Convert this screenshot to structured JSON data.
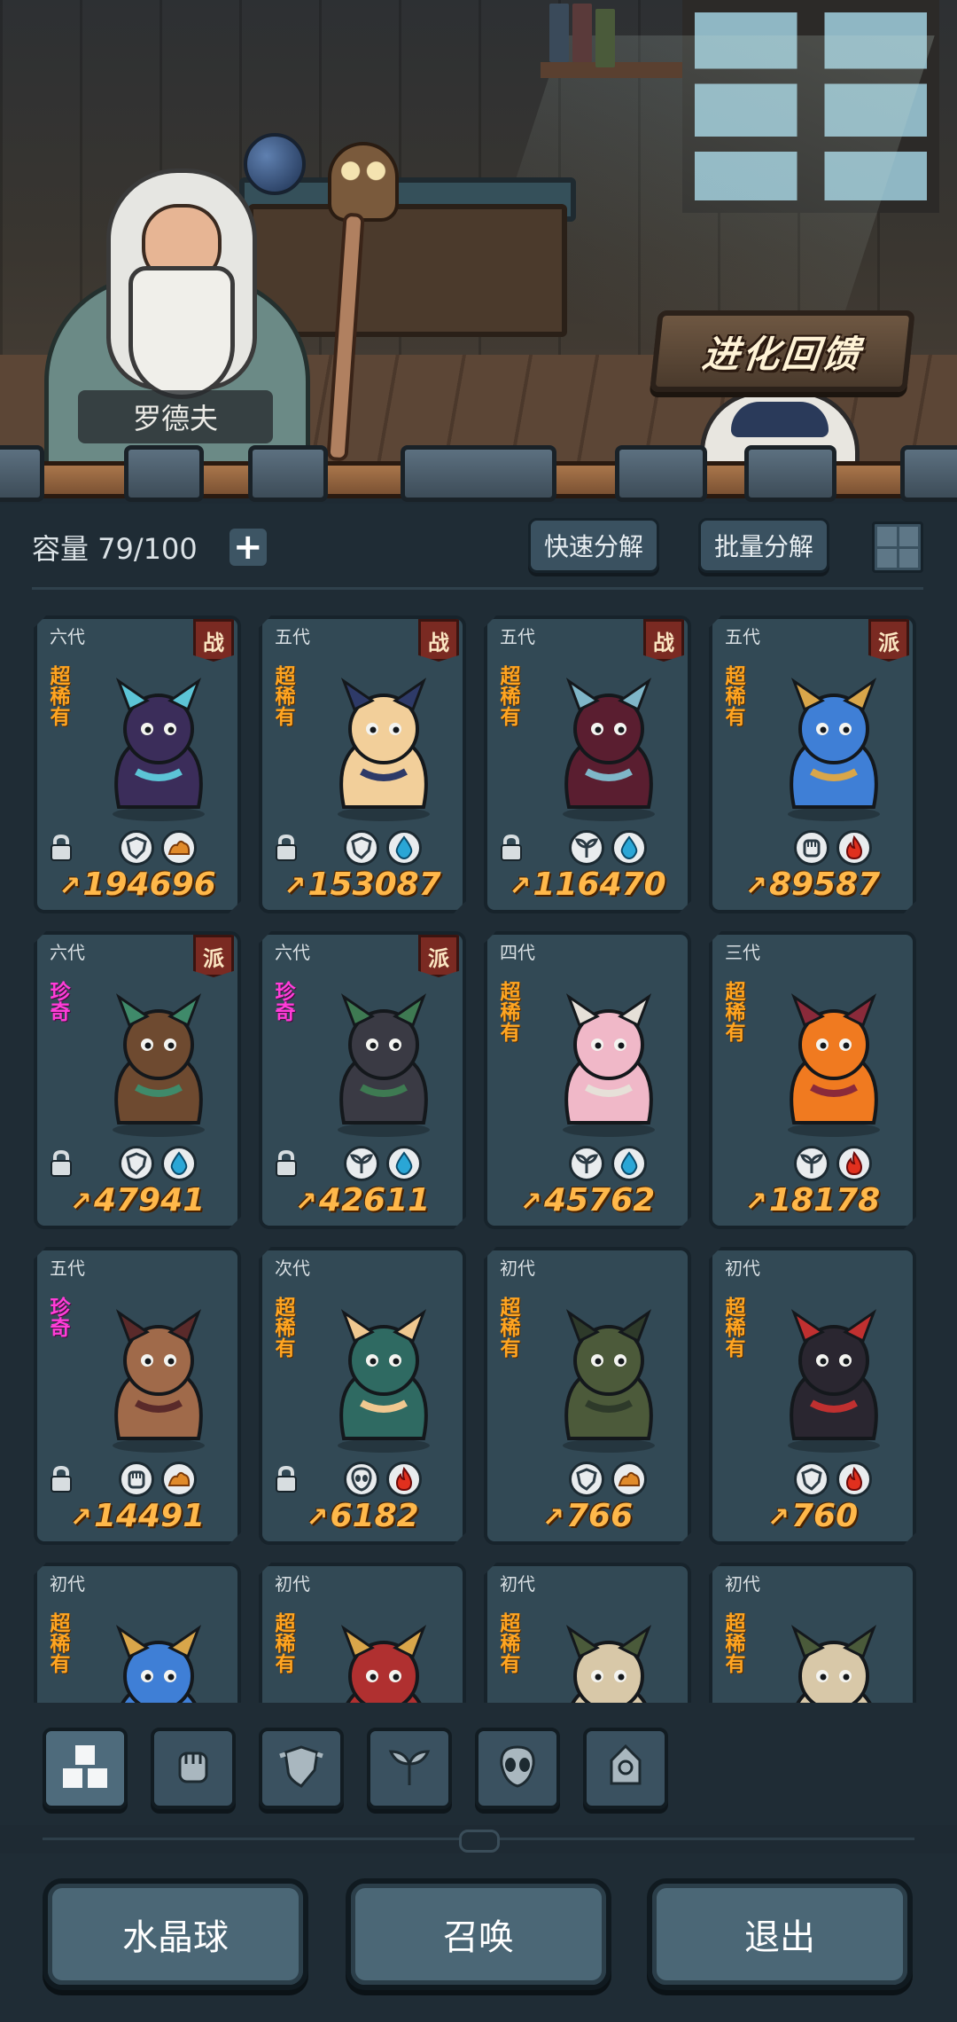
{
  "scene": {
    "npc_name": "罗德夫",
    "evolve_button": "进化回馈"
  },
  "toolbar": {
    "capacity_label": "容量 79/100",
    "add_symbol": "+",
    "quick_decompose": "快速分解",
    "batch_decompose": "批量分解"
  },
  "pets": [
    {
      "gen": "六代",
      "cls": "战",
      "rarity": "超稀有",
      "rarity_type": "ssr",
      "power": "194696",
      "locked": true,
      "badges": [
        "shield",
        "earth"
      ],
      "color": "#3b2d5a",
      "accent": "#5cc4d6"
    },
    {
      "gen": "五代",
      "cls": "战",
      "rarity": "超稀有",
      "rarity_type": "ssr",
      "power": "153087",
      "locked": true,
      "badges": [
        "shield",
        "water"
      ],
      "color": "#f2cf9a",
      "accent": "#2e3a68"
    },
    {
      "gen": "五代",
      "cls": "战",
      "rarity": "超稀有",
      "rarity_type": "ssr",
      "power": "116470",
      "locked": true,
      "badges": [
        "sprout",
        "water"
      ],
      "color": "#5a1e30",
      "accent": "#7fb6c8"
    },
    {
      "gen": "五代",
      "cls": "派",
      "rarity": "超稀有",
      "rarity_type": "ssr",
      "power": "89587",
      "locked": false,
      "badges": [
        "fist",
        "fire"
      ],
      "color": "#3f7fd6",
      "accent": "#d9a64a"
    },
    {
      "gen": "六代",
      "cls": "派",
      "rarity": "珍奇",
      "rarity_type": "rare",
      "power": "47941",
      "locked": true,
      "badges": [
        "shield",
        "water"
      ],
      "color": "#6e4a30",
      "accent": "#3f8a6a"
    },
    {
      "gen": "六代",
      "cls": "派",
      "rarity": "珍奇",
      "rarity_type": "rare",
      "power": "42611",
      "locked": true,
      "badges": [
        "sprout",
        "water"
      ],
      "color": "#3a3a44",
      "accent": "#3e7a52"
    },
    {
      "gen": "四代",
      "cls": "",
      "rarity": "超稀有",
      "rarity_type": "ssr",
      "power": "45762",
      "locked": false,
      "badges": [
        "sprout",
        "water"
      ],
      "color": "#f0b8c8",
      "accent": "#e6e0d8"
    },
    {
      "gen": "三代",
      "cls": "",
      "rarity": "超稀有",
      "rarity_type": "ssr",
      "power": "18178",
      "locked": false,
      "badges": [
        "sprout",
        "fire"
      ],
      "color": "#f07a20",
      "accent": "#8a2a3a"
    },
    {
      "gen": "五代",
      "cls": "",
      "rarity": "珍奇",
      "rarity_type": "rare",
      "power": "14491",
      "locked": true,
      "badges": [
        "fist",
        "earth"
      ],
      "color": "#a06a4a",
      "accent": "#5a2a2a"
    },
    {
      "gen": "次代",
      "cls": "",
      "rarity": "超稀有",
      "rarity_type": "ssr",
      "power": "6182",
      "locked": true,
      "badges": [
        "alien",
        "fire"
      ],
      "color": "#2f6a62",
      "accent": "#f0c890"
    },
    {
      "gen": "初代",
      "cls": "",
      "rarity": "超稀有",
      "rarity_type": "ssr",
      "power": "766",
      "locked": false,
      "badges": [
        "shield",
        "earth"
      ],
      "color": "#4c5a3a",
      "accent": "#2e3a2a"
    },
    {
      "gen": "初代",
      "cls": "",
      "rarity": "超稀有",
      "rarity_type": "ssr",
      "power": "760",
      "locked": false,
      "badges": [
        "shield",
        "fire"
      ],
      "color": "#2a2630",
      "accent": "#c03030"
    },
    {
      "gen": "初代",
      "cls": "",
      "rarity": "超稀有",
      "rarity_type": "ssr",
      "power": "",
      "locked": false,
      "badges": [],
      "color": "#3f7fd6",
      "accent": "#d9a64a"
    },
    {
      "gen": "初代",
      "cls": "",
      "rarity": "超稀有",
      "rarity_type": "ssr",
      "power": "",
      "locked": false,
      "badges": [],
      "color": "#b03030",
      "accent": "#d9a64a"
    },
    {
      "gen": "初代",
      "cls": "",
      "rarity": "超稀有",
      "rarity_type": "ssr",
      "power": "",
      "locked": false,
      "badges": [],
      "color": "#d8c8a8",
      "accent": "#4a5a3a"
    },
    {
      "gen": "初代",
      "cls": "",
      "rarity": "超稀有",
      "rarity_type": "ssr",
      "power": "",
      "locked": false,
      "badges": [],
      "color": "#d8c8a8",
      "accent": "#4a5a3a"
    }
  ],
  "category_tabs": [
    {
      "icon": "all-blocks-icon",
      "active": true
    },
    {
      "icon": "fist-icon",
      "active": false
    },
    {
      "icon": "shield-icon",
      "active": false
    },
    {
      "icon": "sprout-icon",
      "active": false
    },
    {
      "icon": "alien-icon",
      "active": false
    },
    {
      "icon": "tower-icon",
      "active": false
    }
  ],
  "bottom": {
    "crystal_ball": "水晶球",
    "summon": "召唤",
    "exit": "退出"
  }
}
